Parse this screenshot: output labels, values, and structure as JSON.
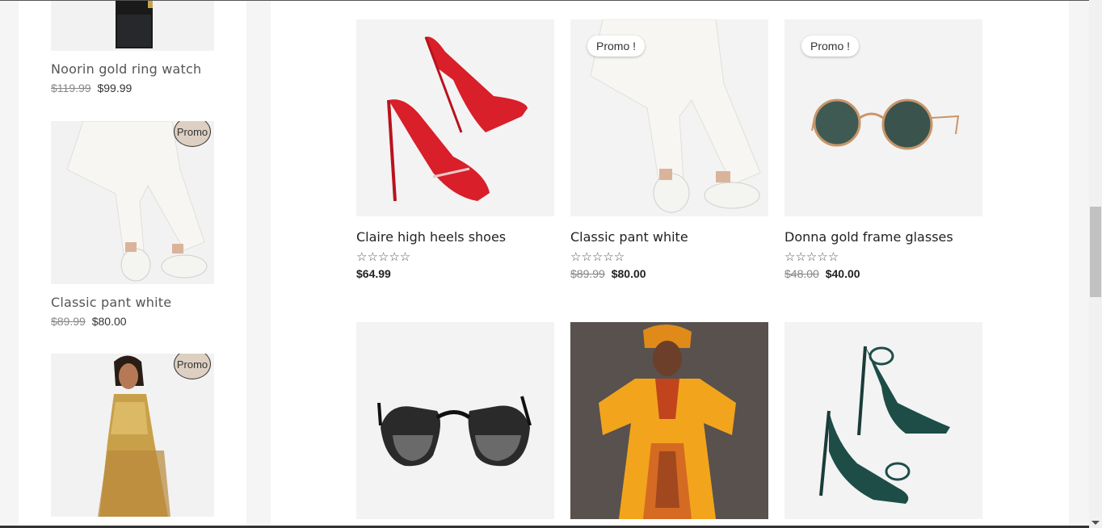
{
  "sidebar": {
    "items": [
      {
        "name": "Noorin gold ring watch",
        "old_price": "$119.99",
        "price": "$99.99",
        "promo": ""
      },
      {
        "name": "Classic pant white",
        "old_price": "$89.99",
        "price": "$80.00",
        "promo": "Promo"
      },
      {
        "name": "",
        "old_price": "",
        "price": "",
        "promo": "Promo"
      }
    ]
  },
  "products": [
    {
      "name": "Claire high heels shoes",
      "stars": "☆☆☆☆☆",
      "old_price": "",
      "price": "$64.99",
      "promo": ""
    },
    {
      "name": "Classic pant white",
      "stars": "☆☆☆☆☆",
      "old_price": "$89.99",
      "price": "$80.00",
      "promo": "Promo !"
    },
    {
      "name": "Donna gold frame glasses",
      "stars": "☆☆☆☆☆",
      "old_price": "$48.00",
      "price": "$40.00",
      "promo": "Promo !"
    },
    {
      "name": "",
      "stars": "",
      "old_price": "",
      "price": "",
      "promo": ""
    },
    {
      "name": "",
      "stars": "",
      "old_price": "",
      "price": "",
      "promo": ""
    },
    {
      "name": "",
      "stars": "",
      "old_price": "",
      "price": "",
      "promo": ""
    }
  ],
  "colors": {
    "promo_circle": "#ddd0c2",
    "image_bg": "#f3f3f3",
    "page_bg": "#f5f5f5"
  }
}
